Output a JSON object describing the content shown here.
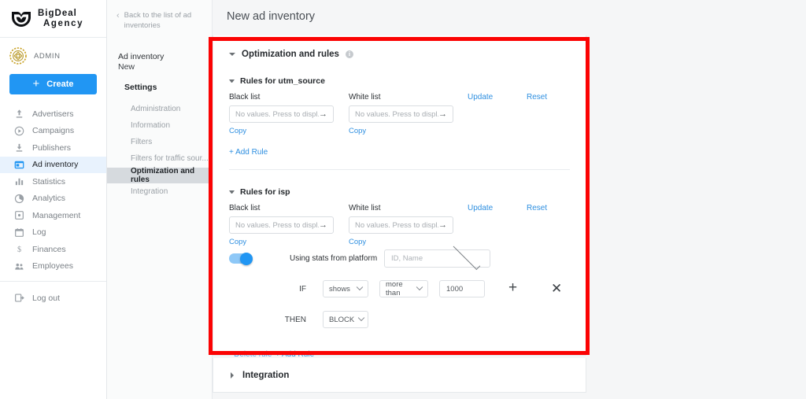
{
  "brand": {
    "line1": "BigDeal",
    "line2": "Agency",
    "logo_icon": "shield-logo-icon"
  },
  "account": {
    "name": "ADMIN",
    "avatar_icon": "user-avatar-icon"
  },
  "sidebar": {
    "create_label": "Create",
    "items": [
      {
        "label": "Advertisers",
        "icon": "upload-icon",
        "active": false
      },
      {
        "label": "Campaigns",
        "icon": "play-circle-icon",
        "active": false
      },
      {
        "label": "Publishers",
        "icon": "download-icon",
        "active": false
      },
      {
        "label": "Ad inventory",
        "icon": "window-icon",
        "active": true
      },
      {
        "label": "Statistics",
        "icon": "bar-chart-icon",
        "active": false
      },
      {
        "label": "Analytics",
        "icon": "pie-chart-icon",
        "active": false
      },
      {
        "label": "Management",
        "icon": "settings-square-icon",
        "active": false
      },
      {
        "label": "Log",
        "icon": "calendar-icon",
        "active": false
      },
      {
        "label": "Finances",
        "icon": "dollar-icon",
        "active": false
      },
      {
        "label": "Employees",
        "icon": "people-icon",
        "active": false
      }
    ],
    "logout": {
      "label": "Log out",
      "icon": "logout-icon"
    }
  },
  "subnav": {
    "back_label": "Back to the list of ad inventories",
    "back_icon": "chevron-left-icon",
    "title": "Ad inventory",
    "subtitle": "New",
    "group_label": "Settings",
    "items": [
      {
        "label": "Administration",
        "active": false
      },
      {
        "label": "Information",
        "active": false
      },
      {
        "label": "Filters",
        "active": false
      },
      {
        "label": "Filters for traffic sour...",
        "active": false
      },
      {
        "label": "Optimization and rules",
        "active": true
      },
      {
        "label": "Integration",
        "active": false
      }
    ]
  },
  "header": {
    "page_title": "New ad inventory"
  },
  "optimization": {
    "section_title": "Optimization and rules",
    "info_icon": "info-icon",
    "collapse_icon": "caret-down-icon",
    "rules": [
      {
        "title": "Rules for utm_source",
        "black_list_label": "Black list",
        "white_list_label": "White list",
        "list_placeholder": "No values. Press to displ...",
        "list_arrow_icon": "arrow-right-icon",
        "copy_label": "Copy",
        "update_label": "Update",
        "reset_label": "Reset",
        "add_rule_label": "+ Add Rule"
      },
      {
        "title": "Rules for isp",
        "black_list_label": "Black list",
        "white_list_label": "White list",
        "list_placeholder": "No values. Press to displ...",
        "list_arrow_icon": "arrow-right-icon",
        "copy_label": "Copy",
        "update_label": "Update",
        "reset_label": "Reset",
        "toggle_on": true,
        "platform_label": "Using stats from platform",
        "platform_value": "ID, Name",
        "condition": {
          "if_label": "IF",
          "metric": "shows",
          "operator": "more than",
          "value": "1000",
          "then_label": "THEN",
          "action": "BLOCK",
          "add_condition_icon": "plus-icon",
          "remove_condition_icon": "close-x-icon"
        },
        "delete_rule_label": "- Delete rule",
        "add_rule_label": "+ Add Rule"
      }
    ]
  },
  "integration": {
    "title": "Integration",
    "expand_icon": "caret-right-icon"
  },
  "annotation": {
    "highlight_color": "#fb0303"
  },
  "colors": {
    "accent": "#2196f3",
    "link": "#2e8fe0",
    "active_nav_bg": "#e8f2fd",
    "active_subnav_bg": "#d6dade",
    "page_bg": "#f5f6f7"
  }
}
